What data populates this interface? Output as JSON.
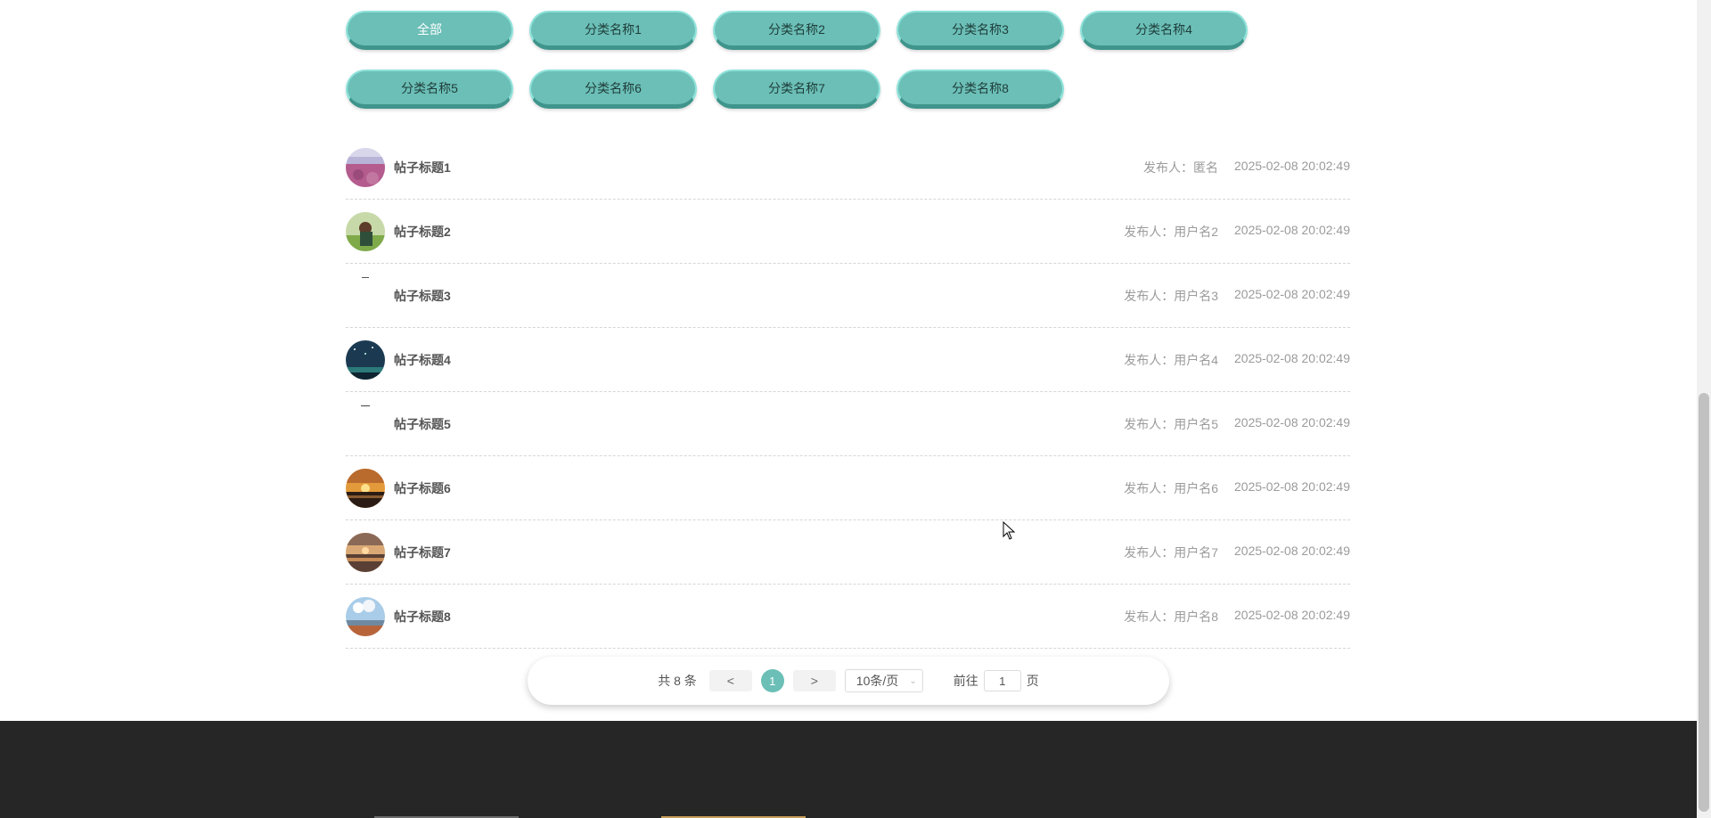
{
  "categories": {
    "row1": [
      "全部",
      "分类名称1",
      "分类名称2",
      "分类名称3",
      "分类名称4"
    ],
    "row2": [
      "分类名称5",
      "分类名称6",
      "分类名称7",
      "分类名称8"
    ],
    "active": "全部",
    "accent_color": "#6bbfb7"
  },
  "posts": [
    {
      "title": "帖子标题1",
      "author_label": "发布人：",
      "author": "匿名",
      "time": "2025-02-08 20:02:49",
      "avatar": "lavender-field-image"
    },
    {
      "title": "帖子标题2",
      "author_label": "发布人：",
      "author": "用户名2",
      "time": "2025-02-08 20:02:49",
      "avatar": "person-field-image"
    },
    {
      "title": "帖子标题3",
      "author_label": "发布人：",
      "author": "用户名3",
      "time": "2025-02-08 20:02:49",
      "avatar": "blank-image"
    },
    {
      "title": "帖子标题4",
      "author_label": "发布人：",
      "author": "用户名4",
      "time": "2025-02-08 20:02:49",
      "avatar": "starry-sky-image"
    },
    {
      "title": "帖子标题5",
      "author_label": "发布人：",
      "author": "用户名5",
      "time": "2025-02-08 20:02:49",
      "avatar": "blank-image"
    },
    {
      "title": "帖子标题6",
      "author_label": "发布人：",
      "author": "用户名6",
      "time": "2025-02-08 20:02:49",
      "avatar": "sunset-sea-image"
    },
    {
      "title": "帖子标题7",
      "author_label": "发布人：",
      "author": "用户名7",
      "time": "2025-02-08 20:02:49",
      "avatar": "sunset-beach-image"
    },
    {
      "title": "帖子标题8",
      "author_label": "发布人：",
      "author": "用户名8",
      "time": "2025-02-08 20:02:49",
      "avatar": "sky-coast-image"
    }
  ],
  "pagination": {
    "total_text": "共 8 条",
    "prev": "<",
    "next": ">",
    "current_page": "1",
    "page_size": "10条/页",
    "goto_label": "前往",
    "goto_value": "1",
    "page_suffix": "页"
  }
}
